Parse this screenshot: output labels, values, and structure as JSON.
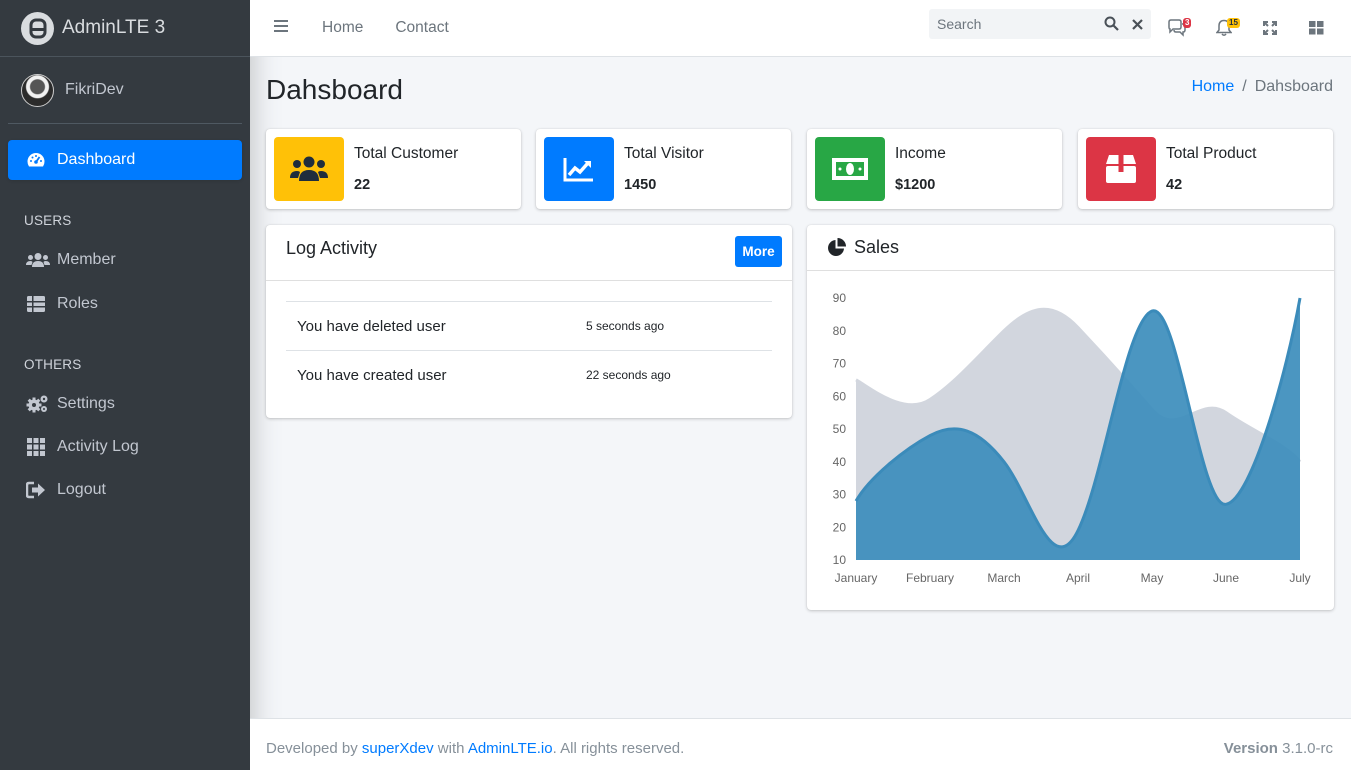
{
  "brand": {
    "name": "AdminLTE 3",
    "logo_icon": "adminlte-logo-icon"
  },
  "user": {
    "name": "FikriDev"
  },
  "sidebar": {
    "active_color": "#007bff",
    "dashboard": {
      "label": "Dashboard",
      "icon": "tachometer-icon"
    },
    "users_header": "USERS",
    "users_items": [
      {
        "label": "Member",
        "icon": "users-icon"
      },
      {
        "label": "Roles",
        "icon": "table-list-icon"
      }
    ],
    "others_header": "OTHERS",
    "others_items": [
      {
        "label": "Settings",
        "icon": "cogs-icon"
      },
      {
        "label": "Activity Log",
        "icon": "grid-icon"
      },
      {
        "label": "Logout",
        "icon": "sign-out-icon"
      }
    ]
  },
  "topbar": {
    "links": [
      "Home",
      "Contact"
    ],
    "search_placeholder": "Search",
    "messages_badge": "3",
    "notifications_badge": "15"
  },
  "page": {
    "title": "Dahsboard",
    "breadcrumb": [
      "Home",
      "Dahsboard"
    ]
  },
  "info_boxes": [
    {
      "label": "Total Customer",
      "value": "22",
      "color": "#ffc107",
      "icon": "users-icon"
    },
    {
      "label": "Total Visitor",
      "value": "1450",
      "color": "#007bff",
      "icon": "chart-line-icon"
    },
    {
      "label": "Income",
      "value": "$1200",
      "color": "#28a745",
      "icon": "money-bill-icon"
    },
    {
      "label": "Total Product",
      "value": "42",
      "color": "#dc3545",
      "icon": "box-icon"
    }
  ],
  "log_activity": {
    "title": "Log Activity",
    "more_label": "More",
    "rows": [
      {
        "action": "You have deleted user",
        "time": "5 seconds ago"
      },
      {
        "action": "You have created user",
        "time": "22 seconds ago"
      }
    ]
  },
  "sales": {
    "title": "Sales",
    "icon": "chart-pie-icon"
  },
  "chart_data": {
    "type": "area",
    "categories": [
      "January",
      "February",
      "March",
      "April",
      "May",
      "June",
      "July"
    ],
    "series": [
      {
        "values": [
          65,
          59,
          80,
          81,
          56,
          55,
          40
        ],
        "color": "#d2d6de"
      },
      {
        "values": [
          28,
          48,
          40,
          19,
          86,
          27,
          90
        ],
        "color": "#3c8dbc"
      }
    ],
    "ylim": [
      10,
      90
    ],
    "yticks": [
      10,
      20,
      30,
      40,
      50,
      60,
      70,
      80,
      90
    ],
    "grid": false,
    "legend": "none"
  },
  "footer": {
    "prefix": "Developed by",
    "author": "superXdev",
    "with": "with",
    "framework": "AdminLTE.io",
    "suffix": ". All rights reserved.",
    "version_label": "Version",
    "version": "3.1.0-rc"
  }
}
